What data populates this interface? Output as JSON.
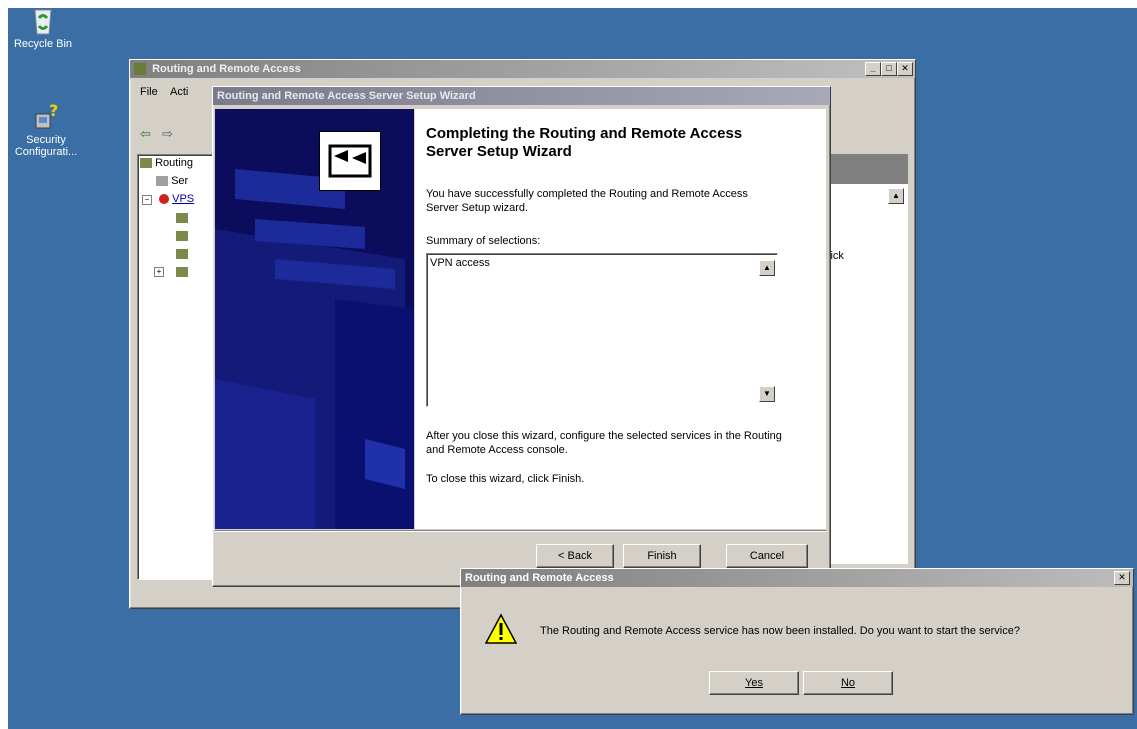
{
  "desktop": {
    "icons": [
      {
        "label": "Recycle Bin",
        "icon": "recycle-bin-icon"
      },
      {
        "label": "Security Configurati...",
        "icon": "security-configuration-icon"
      }
    ]
  },
  "rras_window": {
    "title": "Routing and Remote Access",
    "menu": [
      "File",
      "Acti"
    ],
    "tree_root": "Routing",
    "tree_server_child": "Ser",
    "tree_vps": "VPS",
    "right_text_1": "lick",
    "right_text_2": "."
  },
  "wizard": {
    "title": "Routing and Remote Access Server Setup Wizard",
    "heading": "Completing the Routing and Remote Access Server Setup Wizard",
    "intro": "You have successfully completed the Routing and Remote Access Server Setup wizard.",
    "summary_label": "Summary of selections:",
    "summary_value": "VPN access",
    "after_close": "After you close this wizard, configure the selected services in the Routing and  Remote Access console.",
    "close_hint": "To close this wizard, click Finish.",
    "buttons": {
      "back": "< Back",
      "finish": "Finish",
      "cancel": "Cancel"
    }
  },
  "dialog": {
    "title": "Routing and Remote Access",
    "message": "The Routing and Remote Access service has now been installed.  Do you want to start the service?",
    "icon": "warning-icon",
    "buttons": {
      "yes": "Yes",
      "no": "No"
    }
  },
  "colors": {
    "desktop": "#3a6ea5",
    "active_title": "#0a246a",
    "inactive_title": "#808080",
    "wizard_sidebar": "#0c0c5c"
  }
}
